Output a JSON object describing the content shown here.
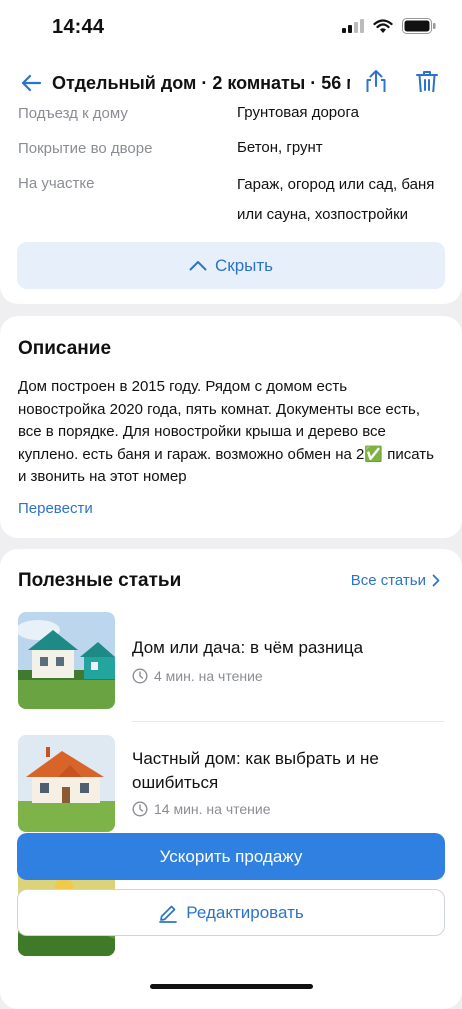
{
  "status": {
    "time": "14:44"
  },
  "nav": {
    "title": "Отдельный дом · 2 комнаты · 56 м..."
  },
  "details": {
    "rows": [
      {
        "label": "Подъезд к дому",
        "value": "Грунтовая дорога"
      },
      {
        "label": "Покрытие во дворе",
        "value": "Бетон, грунт"
      },
      {
        "label": "На участке",
        "value": "Гараж, огород или сад, баня или сауна, хозпостройки"
      }
    ],
    "hide_label": "Скрыть"
  },
  "description": {
    "title": "Описание",
    "text": "Дом построен в 2015 году. Рядом с домом есть новостройка 2020 года, пять комнат. Документы все есть, все в порядке. Для новостройки крыша и дерево все куплено. есть баня и гараж. возможно обмен на 2✅ писать и звонить на этот номер",
    "translate": "Перевести"
  },
  "articles": {
    "title": "Полезные статьи",
    "all_link": "Все статьи",
    "items": [
      {
        "title": "Дом или дача: в чём разница",
        "meta": "4 мин. на чтение"
      },
      {
        "title": "Частный дом: как выбрать и не ошибиться",
        "meta": "14 мин. на чтение"
      }
    ]
  },
  "actions": {
    "boost": "Ускорить продажу",
    "edit": "Редактировать"
  },
  "colors": {
    "accent": "#2c74c9",
    "primary_button": "#2f80e0",
    "light_button": "#e6effa"
  }
}
